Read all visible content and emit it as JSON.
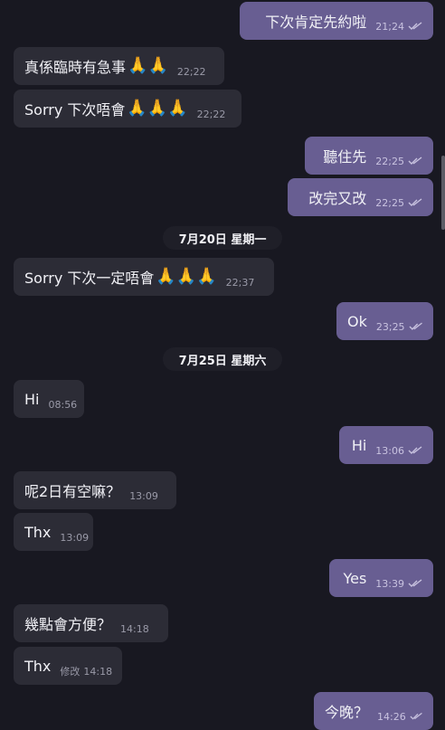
{
  "colors": {
    "background": "#181821",
    "incoming_bubble": "#2c2c36",
    "outgoing_bubble": "#685e92",
    "tick": "#c9c3e0"
  },
  "messages": [
    {
      "text": "下次肯定先約啦",
      "time": "21;24",
      "dir": "out"
    },
    {
      "text": "真係臨時有急事",
      "time": "22;22",
      "dir": "in",
      "emoji": "🙏🙏"
    },
    {
      "text": "Sorry 下次唔會",
      "time": "22;22",
      "dir": "in",
      "emoji": "🙏🙏🙏"
    },
    {
      "text": "聽住先",
      "time": "22;25",
      "dir": "out"
    },
    {
      "text": "改完又改",
      "time": "22;25",
      "dir": "out"
    },
    {
      "text": "Sorry 下次一定唔會",
      "time": "22;37",
      "dir": "in",
      "emoji": "🙏🙏🙏"
    },
    {
      "text": "Ok",
      "time": "23;25",
      "dir": "out"
    },
    {
      "text": "Hi",
      "time": "08:56",
      "dir": "in"
    },
    {
      "text": "Hi",
      "time": "13:06",
      "dir": "out"
    },
    {
      "text": "呢2日有空嘛？",
      "time": "13:09",
      "dir": "in"
    },
    {
      "text": "Thx",
      "time": "13:09",
      "dir": "in"
    },
    {
      "text": "Yes",
      "time": "13:39",
      "dir": "out"
    },
    {
      "text": "幾點會方便？",
      "time": "14:18",
      "dir": "in"
    },
    {
      "text": "Thx",
      "time": "14:18",
      "dir": "in",
      "edited": "修改"
    },
    {
      "text": "今晚？",
      "time": "14:26",
      "dir": "out"
    }
  ],
  "dates": [
    "7月20日 星期一",
    "7月25日 星期六"
  ]
}
